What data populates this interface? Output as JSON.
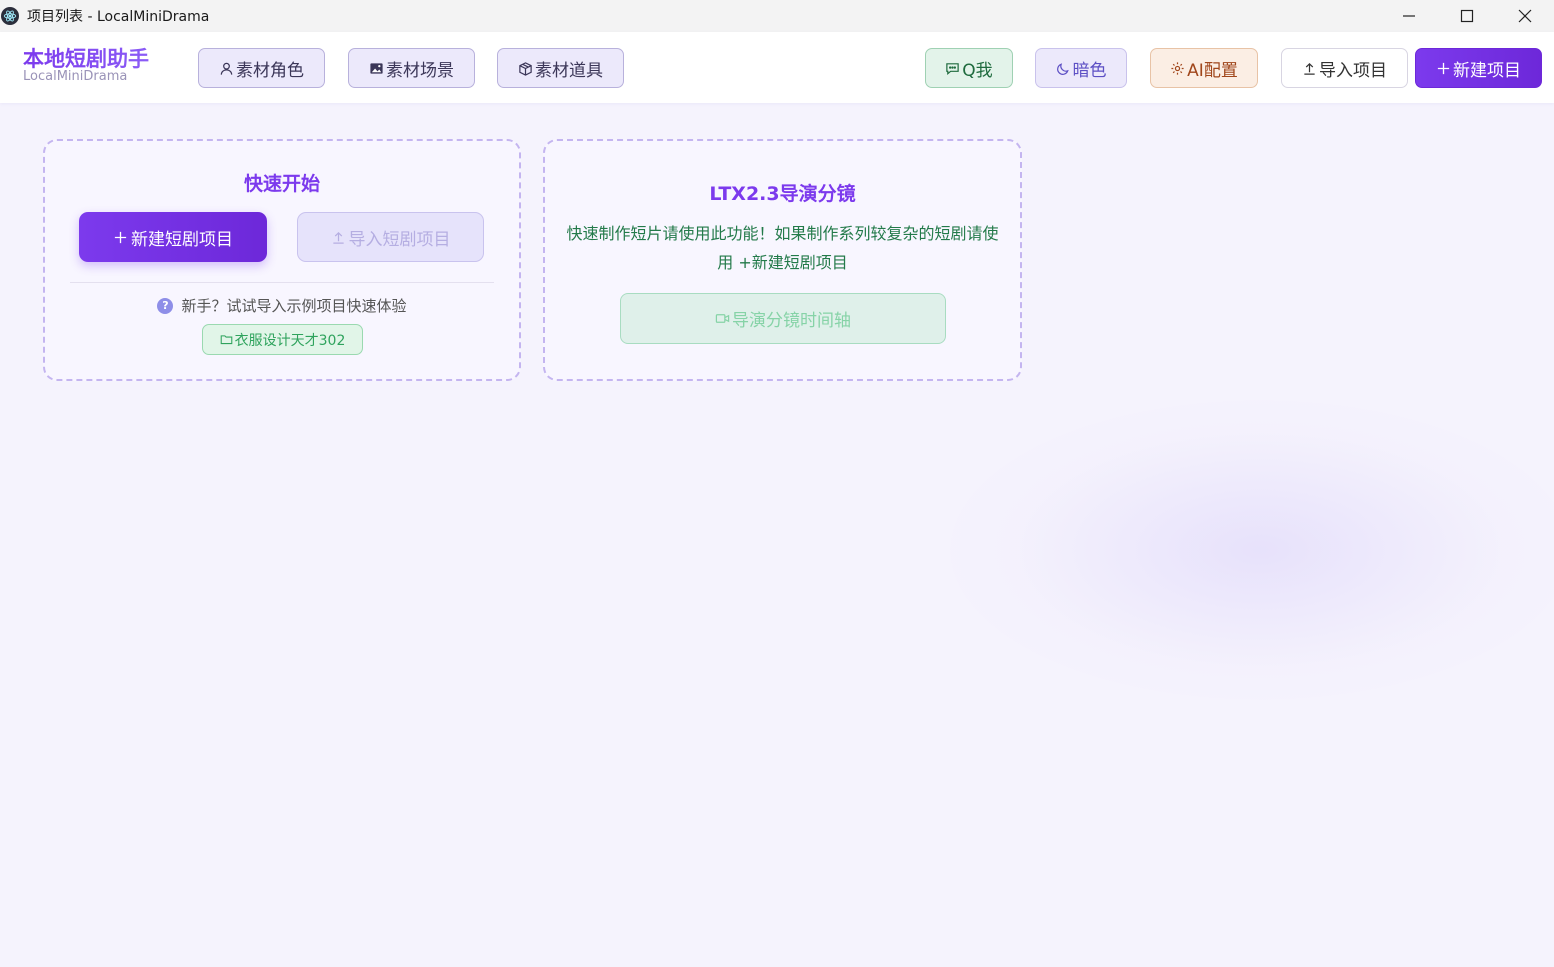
{
  "window": {
    "title": "项目列表 - LocalMiniDrama"
  },
  "brand": {
    "title": "本地短剧助手",
    "subtitle": "LocalMiniDrama"
  },
  "header": {
    "asset_buttons": [
      "素材角色",
      "素材场景",
      "素材道具"
    ],
    "qq_label": "Q我",
    "dark_label": "暗色",
    "ai_label": "AI配置",
    "import_label": "导入项目",
    "new_label": "新建项目"
  },
  "quick_start": {
    "title": "快速开始",
    "new_label": "新建短剧项目",
    "import_label": "导入短剧项目",
    "hint": "新手？试试导入示例项目快速体验",
    "hint_icon": "?",
    "sample_label": "衣服设计天才302"
  },
  "ltx": {
    "title": "LTX2.3导演分镜",
    "description": "快速制作短片请使用此功能！如果制作系列较复杂的短剧请使用 +新建短剧项目",
    "button_label": "导演分镜时间轴"
  },
  "colors": {
    "accent": "#7c3aed",
    "green_text": "#237a4a",
    "background": "#f5f3fd"
  },
  "icons": {
    "app": "electron-icon",
    "minimize": "minimize-icon",
    "maximize": "maximize-icon",
    "close": "close-icon",
    "character": "user-icon",
    "scene": "image-icon",
    "prop": "box-icon",
    "qq": "chat-icon",
    "dark": "moon-icon",
    "ai": "gear-icon",
    "import": "upload-icon",
    "new": "plus-icon",
    "folder": "folder-icon",
    "video": "video-icon",
    "help": "question-icon"
  }
}
